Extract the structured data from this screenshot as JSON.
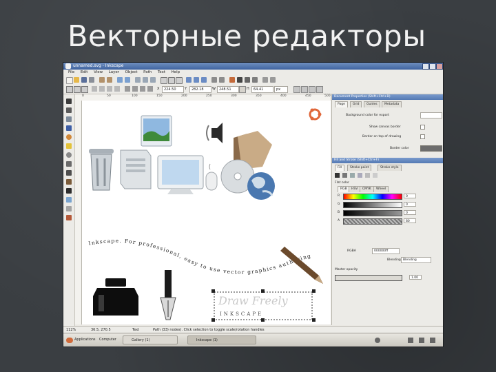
{
  "slide": {
    "title": "Векторные редакторы"
  },
  "window": {
    "title": "unnamed.svg - Inkscape"
  },
  "menu": [
    "File",
    "Edit",
    "View",
    "Layer",
    "Object",
    "Path",
    "Text",
    "Help"
  ],
  "controls": {
    "x_label": "X",
    "x_value": "224.50",
    "y_label": "Y",
    "y_value": "282.18",
    "w_label": "W",
    "w_value": "248.51",
    "h_label": "H",
    "h_value": "64.41",
    "units": "px"
  },
  "ruler": {
    "numbers": [
      "0",
      "50",
      "100",
      "150",
      "200",
      "250",
      "300",
      "350",
      "400",
      "450",
      "500"
    ]
  },
  "canvas": {
    "wave_text_1": "Inkscape. For professional, easy to use vector graphics authoring",
    "draw_freely": "Draw Freely",
    "inkscape_logo": "INKSCAPE"
  },
  "docprops": {
    "title": "Document Properties (Shift+Ctrl+D)",
    "tabs": [
      "Page",
      "Grid",
      "Guides",
      "Metadata"
    ],
    "bg_label": "Background color for export",
    "show_border_label": "Show canvas border",
    "border_top_label": "Border on top of drawing",
    "border_color_label": "Border color"
  },
  "fillstroke": {
    "title": "Fill and Stroke (Shift+Ctrl+F)",
    "tabs": [
      "Fill",
      "Stroke paint",
      "Stroke style"
    ],
    "flat_color": "Flat color",
    "model_tabs": [
      "RGB",
      "HSV",
      "CMYK",
      "Wheel"
    ],
    "channels": [
      {
        "label": "R",
        "value": "0"
      },
      {
        "label": "G",
        "value": "0"
      },
      {
        "label": "B",
        "value": "0"
      },
      {
        "label": "A",
        "value": "80"
      }
    ],
    "rgba_label": "RGBA",
    "rgba_value": "000000ff",
    "blend_label": "Blending",
    "master_opacity": "Master opacity",
    "opacity_value": "1.00",
    "colors": {
      "border_swatch": "#6d6d6d",
      "hue_gradient": "linear-gradient(90deg,#ff0000,#ffff00,#00ff00,#00ffff,#0000ff,#ff00ff,#ff0000)"
    }
  },
  "status": {
    "zoom": "112%",
    "coords": "36.5, 270.5",
    "layer": "Text",
    "message": "Path (33) nodes). Click selection to toggle scale/rotation handles"
  },
  "taskbar": {
    "applications": "Applications",
    "computer": "Computer",
    "items": [
      {
        "label": "Gallery (1)"
      },
      {
        "label": "Inkscape (1)"
      }
    ]
  }
}
